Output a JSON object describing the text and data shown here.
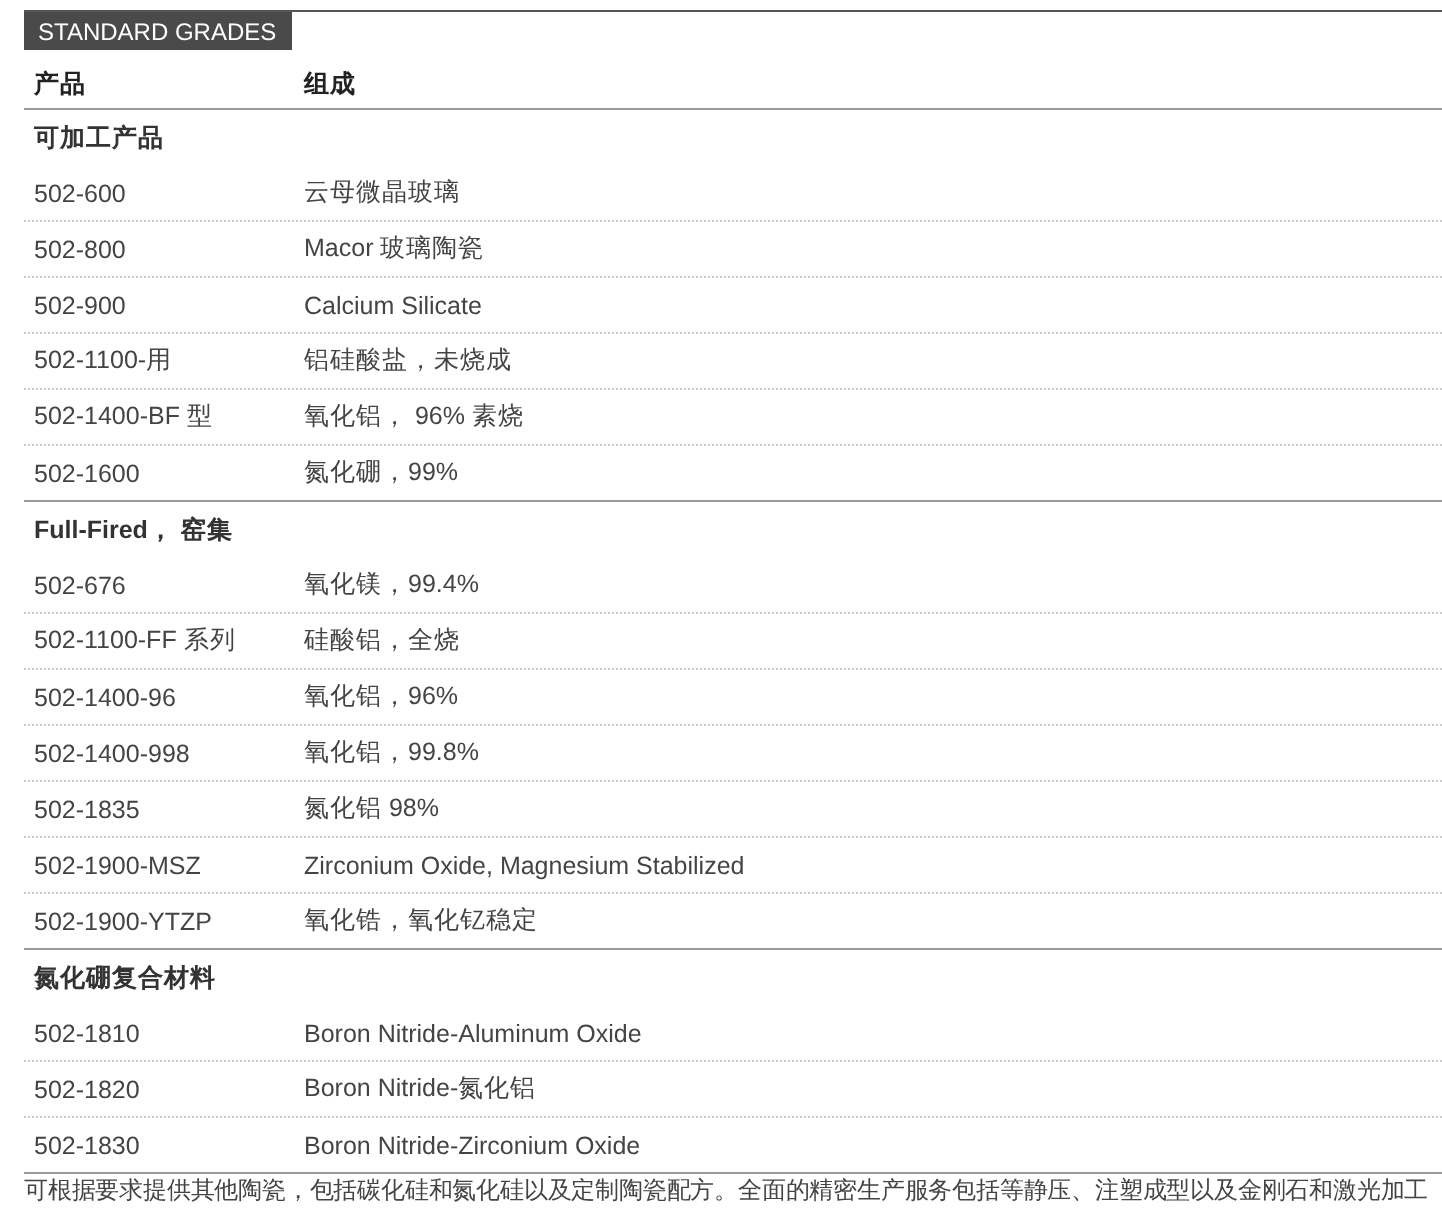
{
  "title_tab": "STANDARD GRADES",
  "columns": [
    "产品",
    "组成"
  ],
  "sections": [
    {
      "title": "可加工产品",
      "rows": [
        [
          "502-600",
          "云母微晶玻璃"
        ],
        [
          "502-800",
          "Macor 玻璃陶瓷"
        ],
        [
          "502-900",
          "Calcium Silicate"
        ],
        [
          "502-1100-用",
          "铝硅酸盐，未烧成"
        ],
        [
          "502-1400-BF 型",
          "氧化铝， 96% 素烧"
        ],
        [
          "502-1600",
          "氮化硼，99%"
        ]
      ]
    },
    {
      "title": "Full-Fired， 窑集",
      "rows": [
        [
          "502-676",
          "氧化镁，99.4%"
        ],
        [
          "502-1100-FF 系列",
          "硅酸铝，全烧"
        ],
        [
          "502-1400-96",
          "氧化铝，96%"
        ],
        [
          "502-1400-998",
          "氧化铝，99.8%"
        ],
        [
          "502-1835",
          "氮化铝 98%"
        ],
        [
          "502-1900-MSZ",
          "Zirconium Oxide, Magnesium Stabilized"
        ],
        [
          "502-1900-YTZP",
          "氧化锆，氧化钇稳定"
        ]
      ]
    },
    {
      "title": "氮化硼复合材料",
      "rows": [
        [
          "502-1810",
          "Boron Nitride-Aluminum Oxide"
        ],
        [
          "502-1820",
          "Boron Nitride-氮化铝"
        ],
        [
          "502-1830",
          "Boron Nitride-Zirconium Oxide"
        ]
      ]
    }
  ],
  "footnote": "可根据要求提供其他陶瓷，包括碳化硅和氮化硅以及定制陶瓷配方。全面的精密生产服务包括等静压、注塑成型以及金刚石和激光加工"
}
